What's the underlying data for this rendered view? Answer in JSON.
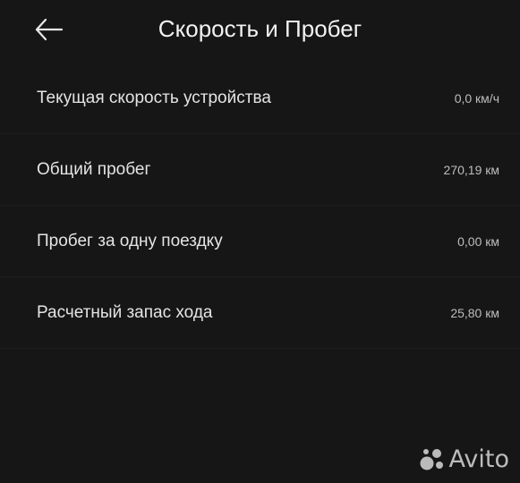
{
  "header": {
    "title": "Скорость и Пробег"
  },
  "rows": [
    {
      "label": "Текущая скорость устройства",
      "value": "0,0 км/ч"
    },
    {
      "label": "Общий пробег",
      "value": "270,19 км"
    },
    {
      "label": "Пробег за одну поездку",
      "value": "0,00 км"
    },
    {
      "label": "Расчетный запас хода",
      "value": "25,80 км"
    }
  ],
  "icons": {
    "back": "arrow-left-icon",
    "watermark": "avito-dots-icon"
  },
  "watermark": {
    "text": "Avito"
  },
  "colors": {
    "background": "#161616",
    "text_primary": "#e4e4e4",
    "text_secondary": "#bdbdbd"
  }
}
